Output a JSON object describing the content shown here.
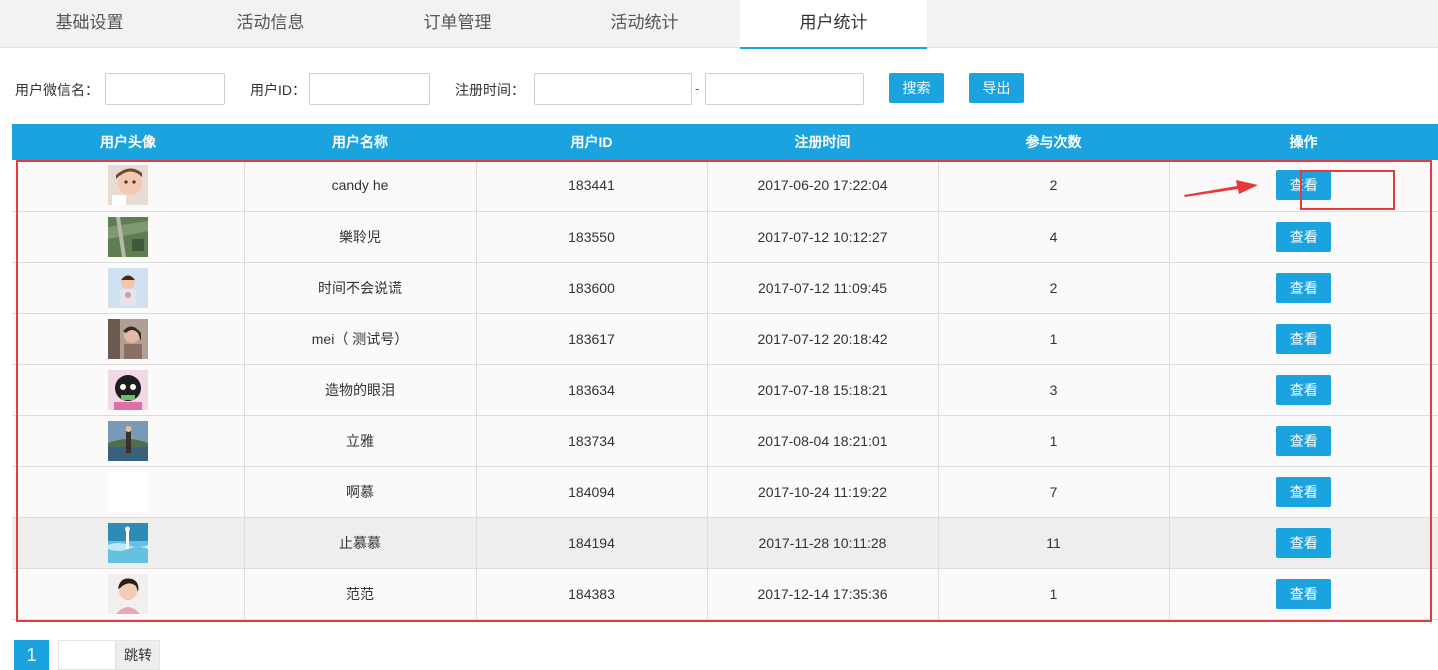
{
  "tabs": [
    {
      "label": "基础设置"
    },
    {
      "label": "活动信息"
    },
    {
      "label": "订单管理"
    },
    {
      "label": "活动统计"
    },
    {
      "label": "用户统计"
    }
  ],
  "active_tab": 4,
  "filters": {
    "nickname_label": "用户微信名：",
    "nickname_value": "",
    "userid_label": "用户ID：",
    "userid_value": "",
    "regtime_label": "注册时间：",
    "regtime_start": "",
    "regtime_end": "",
    "separator": "-",
    "search_label": "搜索",
    "export_label": "导出"
  },
  "table": {
    "headers": [
      "用户头像",
      "用户名称",
      "用户ID",
      "注册时间",
      "参与次数",
      "操作"
    ],
    "rows": [
      {
        "avatar": "avatar-baby-photo",
        "name": "candy he",
        "id": "183441",
        "time": "2017-06-20 17:22:04",
        "count": "2",
        "action": "查看"
      },
      {
        "avatar": "avatar-aerial-photo",
        "name": "樂聆児",
        "id": "183550",
        "time": "2017-07-12 10:12:27",
        "count": "4",
        "action": "查看"
      },
      {
        "avatar": "avatar-child-photo",
        "name": "时间不会说谎",
        "id": "183600",
        "time": "2017-07-12 11:09:45",
        "count": "2",
        "action": "查看"
      },
      {
        "avatar": "avatar-car-photo",
        "name": "mei（ 测试号）",
        "id": "183617",
        "time": "2017-07-12 20:18:42",
        "count": "1",
        "action": "查看"
      },
      {
        "avatar": "avatar-cartoon-photo",
        "name": "造物的眼泪",
        "id": "183634",
        "time": "2017-07-18 15:18:21",
        "count": "3",
        "action": "查看"
      },
      {
        "avatar": "avatar-lake-photo",
        "name": "立雅",
        "id": "183734",
        "time": "2017-08-04 18:21:01",
        "count": "1",
        "action": "查看"
      },
      {
        "avatar": "avatar-blank",
        "name": "啊慕",
        "id": "184094",
        "time": "2017-10-24 11:19:22",
        "count": "7",
        "action": "查看"
      },
      {
        "avatar": "avatar-ocean-photo",
        "name": "止慕慕",
        "id": "184194",
        "time": "2017-11-28 10:11:28",
        "count": "11",
        "action": "查看"
      },
      {
        "avatar": "avatar-woman-photo",
        "name": "范范",
        "id": "184383",
        "time": "2017-12-14 17:35:36",
        "count": "1",
        "action": "查看"
      }
    ]
  },
  "highlighted_row": 7,
  "pagination": {
    "current_page": "1",
    "jump_value": "",
    "jump_label": "跳转"
  },
  "colors": {
    "accent": "#1aa3de",
    "annotation": "#e8393d"
  }
}
